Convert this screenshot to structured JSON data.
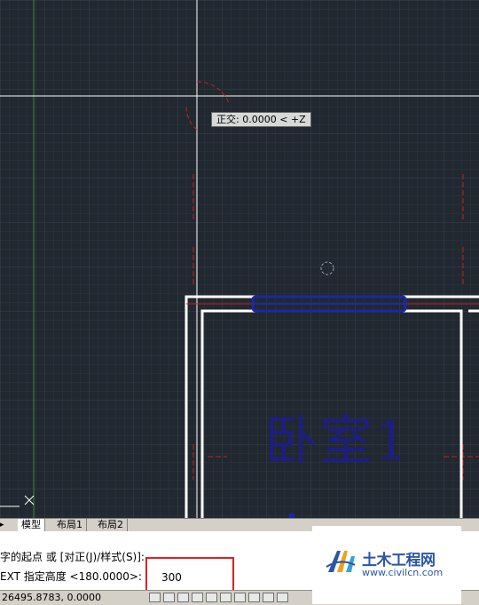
{
  "canvas": {
    "tooltip_text": "正交: 0.0000 < +Z",
    "room_label": "卧室1"
  },
  "tabs": [
    {
      "label": "模型",
      "active": true
    },
    {
      "label": "布局1",
      "active": false
    },
    {
      "label": "布局2",
      "active": false
    }
  ],
  "command_line": {
    "history": "字的起点 或 [对正(J)/样式(S)]:",
    "prompt": "EXT 指定高度 <180.0000>:",
    "input_value": "300"
  },
  "status_bar": {
    "coordinates": "26495.8783, 0.0000"
  },
  "watermark": {
    "title": "土木工程网",
    "url": "www.civilcn.com"
  },
  "colors": {
    "background": "#212830",
    "grid": "#2e3844",
    "crosshair": "#ffffff",
    "wall": "#ffffff",
    "dimension_red": "#c81e1e",
    "selection_blue": "#1a28a8",
    "highlight": "#e02020",
    "brand_blue": "#2a56a6"
  }
}
